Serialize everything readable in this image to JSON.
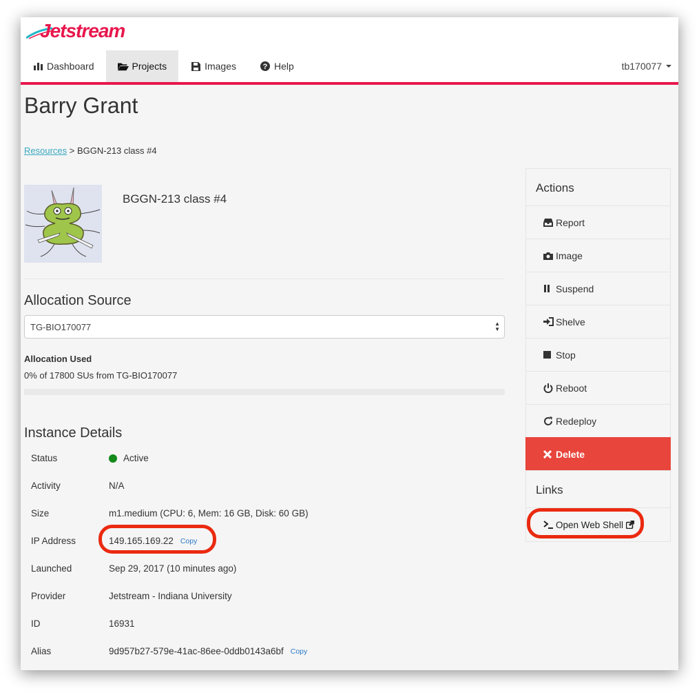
{
  "brand": {
    "logo_text": "Jetstream"
  },
  "nav": {
    "items": [
      {
        "label": "Dashboard",
        "icon": "bar-chart-icon",
        "active": false
      },
      {
        "label": "Projects",
        "icon": "folder-open-icon",
        "active": true
      },
      {
        "label": "Images",
        "icon": "floppy-disk-icon",
        "active": false
      },
      {
        "label": "Help",
        "icon": "question-circle-icon",
        "active": false
      }
    ],
    "user": "tb170077"
  },
  "page": {
    "title": "Barry Grant",
    "breadcrumb": {
      "link": "Resources",
      "separator": ">",
      "current": "BGGN-213 class #4"
    },
    "project_name": "BGGN-213 class #4"
  },
  "allocation": {
    "section_title": "Allocation Source",
    "selected": "TG-BIO170077",
    "used_label": "Allocation Used",
    "used_text": "0% of 17800 SUs from TG-BIO170077",
    "used_percent": 0
  },
  "instance": {
    "section_title": "Instance Details",
    "rows": [
      {
        "label": "Status",
        "value": "Active",
        "status_color": "#138a1a"
      },
      {
        "label": "Activity",
        "value": "N/A"
      },
      {
        "label": "Size",
        "value": "m1.medium (CPU: 6, Mem: 16 GB, Disk: 60 GB)"
      },
      {
        "label": "IP Address",
        "value": "149.165.169.22",
        "copy": "Copy"
      },
      {
        "label": "Launched",
        "value": "Sep 29, 2017 (10 minutes ago)"
      },
      {
        "label": "Provider",
        "value": "Jetstream - Indiana University"
      },
      {
        "label": "ID",
        "value": "16931"
      },
      {
        "label": "Alias",
        "value": "9d957b27-579e-41ac-86ee-0ddb0143a6bf",
        "copy": "Copy"
      }
    ]
  },
  "sidebar": {
    "actions_title": "Actions",
    "actions": [
      {
        "label": "Report",
        "icon": "inbox-icon"
      },
      {
        "label": "Image",
        "icon": "camera-icon"
      },
      {
        "label": "Suspend",
        "icon": "pause-icon"
      },
      {
        "label": "Shelve",
        "icon": "sign-in-icon"
      },
      {
        "label": "Stop",
        "icon": "stop-icon"
      },
      {
        "label": "Reboot",
        "icon": "power-icon"
      },
      {
        "label": "Redeploy",
        "icon": "refresh-icon"
      },
      {
        "label": "Delete",
        "icon": "times-icon",
        "danger": true
      }
    ],
    "links_title": "Links",
    "web_shell": "Open Web Shell"
  },
  "colors": {
    "accent": "#e8174d",
    "danger": "#e8453c",
    "annotation": "#ea2a10",
    "link": "#3aa8c1"
  }
}
